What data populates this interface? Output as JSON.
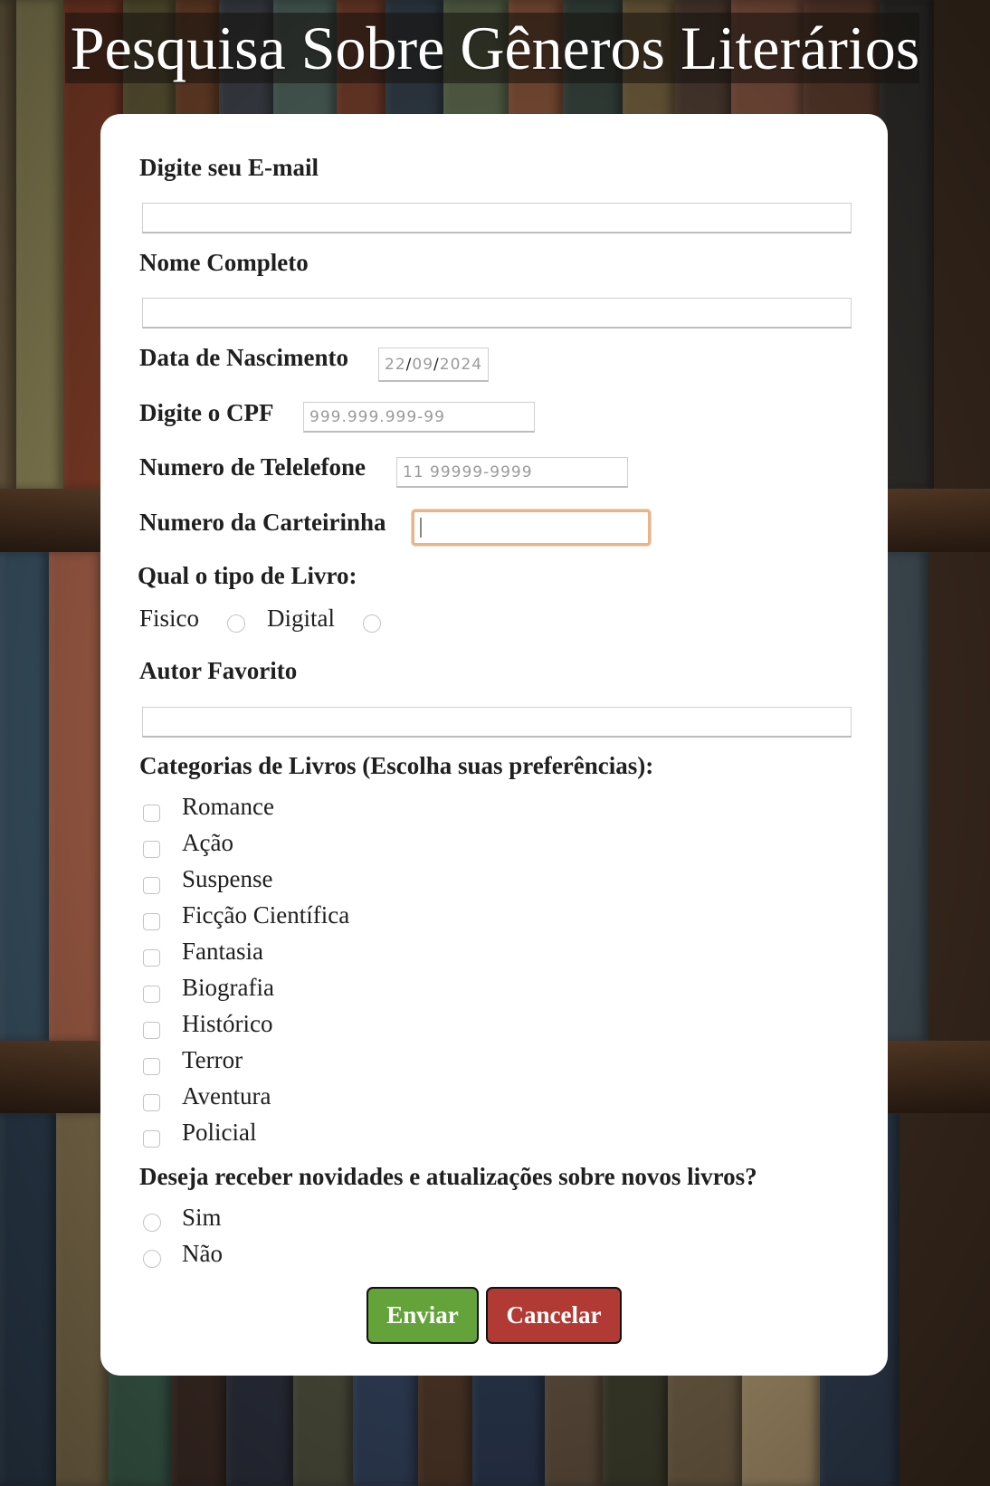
{
  "page": {
    "title": "Pesquisa Sobre Gêneros Literários"
  },
  "form": {
    "email": {
      "label": "Digite seu E-mail",
      "value": ""
    },
    "full_name": {
      "label": "Nome Completo",
      "value": ""
    },
    "birth_date": {
      "label": "Data de Nascimento",
      "day": "22",
      "month": "09",
      "year": "2024"
    },
    "cpf": {
      "label": "Digite o CPF",
      "placeholder": "999.999.999-99"
    },
    "phone": {
      "label": "Numero de Telelefone",
      "placeholder": "11 99999-9999"
    },
    "card_number": {
      "label": "Numero da Carteirinha",
      "value": ""
    },
    "book_type": {
      "label": "Qual o tipo de Livro:",
      "options": [
        "Fisico",
        "Digital"
      ]
    },
    "favorite_author": {
      "label": "Autor Favorito",
      "value": ""
    },
    "categories": {
      "label": "Categorias de Livros (Escolha suas preferências):",
      "options": [
        "Romance",
        "Ação",
        "Suspense",
        "Ficção Científica",
        "Fantasia",
        "Biografia",
        "Histórico",
        "Terror",
        "Aventura",
        "Policial"
      ]
    },
    "newsletter": {
      "label": "Deseja receber novidades e atualizações sobre novos livros?",
      "options": [
        "Sim",
        "Não"
      ]
    },
    "buttons": {
      "submit": "Enviar",
      "cancel": "Cancelar"
    }
  },
  "colors": {
    "submit": "#63a33a",
    "cancel": "#b13a34",
    "focus_ring": "#e8b48a",
    "card": "#ffffff"
  }
}
